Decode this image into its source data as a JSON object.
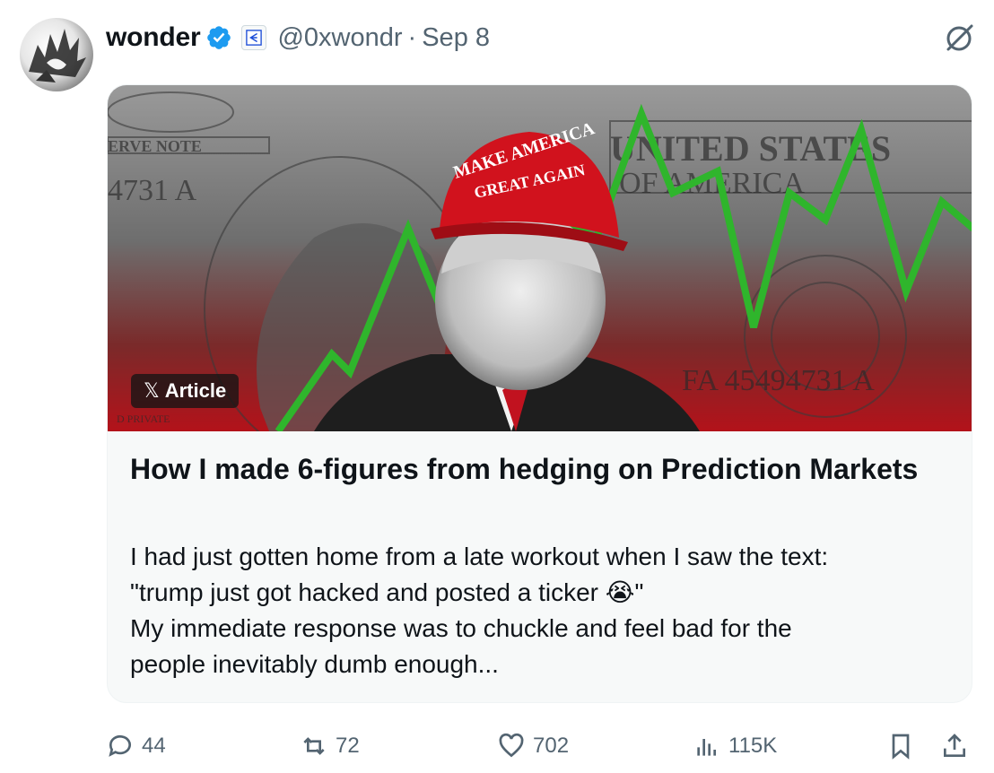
{
  "author": {
    "name": "wonder",
    "handle": "@0xwondr",
    "separator": "·",
    "date": "Sep 8"
  },
  "article": {
    "badge_label": "Article",
    "title": "How I made 6-figures from hedging on Prediction Markets",
    "excerpt_lines": [
      "I had just gotten home from a late workout when I saw the text:",
      "\"trump just got hacked and posted a ticker 😭\"",
      "My immediate response was to chuckle and feel bad for the",
      "people inevitably dumb enough..."
    ]
  },
  "stats": {
    "replies": "44",
    "reposts": "72",
    "likes": "702",
    "views": "115K"
  },
  "colors": {
    "verified_blue": "#1d9bf0",
    "muted_text": "#536471",
    "chart_green": "#2fb52c",
    "cover_red": "#a3141b"
  },
  "icons": [
    "verified-badge-icon",
    "affiliate-icon",
    "grok-icon",
    "x-logo-icon",
    "reply-icon",
    "repost-icon",
    "like-icon",
    "views-icon",
    "bookmark-icon",
    "share-icon"
  ]
}
